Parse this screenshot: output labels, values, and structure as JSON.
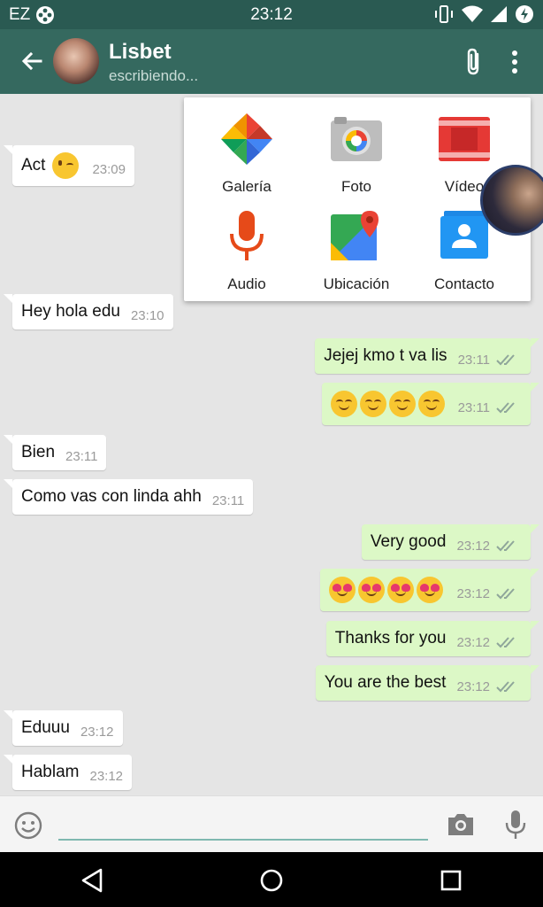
{
  "status_bar": {
    "carrier": "EZ",
    "time": "23:12"
  },
  "header": {
    "contact_name": "Lisbet",
    "contact_status": "escribiendo..."
  },
  "attach_menu": {
    "items": [
      {
        "label": "Galería",
        "icon": "gallery-icon"
      },
      {
        "label": "Foto",
        "icon": "camera-icon"
      },
      {
        "label": "Vídeo",
        "icon": "video-icon"
      },
      {
        "label": "Audio",
        "icon": "microphone-icon"
      },
      {
        "label": "Ubicación",
        "icon": "location-icon"
      },
      {
        "label": "Contacto",
        "icon": "contact-icon"
      }
    ]
  },
  "messages": [
    {
      "direction": "in",
      "text": "Act",
      "emoji": [
        "wink"
      ],
      "time": "23:09"
    },
    {
      "direction": "in",
      "text": "Hey hola edu",
      "time": "23:10"
    },
    {
      "direction": "out",
      "text": "Jejej kmo t va lis",
      "time": "23:11",
      "read": true
    },
    {
      "direction": "out",
      "text": "",
      "emoji": [
        "smile",
        "smile",
        "smile",
        "smile"
      ],
      "time": "23:11",
      "read": true
    },
    {
      "direction": "in",
      "text": "Bien",
      "time": "23:11"
    },
    {
      "direction": "in",
      "text": "Como vas con linda ahh",
      "time": "23:11"
    },
    {
      "direction": "out",
      "text": "Very good",
      "time": "23:12",
      "read": true
    },
    {
      "direction": "out",
      "text": "",
      "emoji": [
        "heart-eyes",
        "heart-eyes",
        "heart-eyes",
        "heart-eyes"
      ],
      "time": "23:12",
      "read": true
    },
    {
      "direction": "out",
      "text": "Thanks for you",
      "time": "23:12",
      "read": true
    },
    {
      "direction": "out",
      "text": "You are the best",
      "time": "23:12",
      "read": true
    },
    {
      "direction": "in",
      "text": "Eduuu",
      "time": "23:12"
    },
    {
      "direction": "in",
      "text": "Hablam",
      "time": "23:12"
    }
  ],
  "input": {
    "value": "",
    "placeholder": ""
  },
  "colors": {
    "statusbar": "#2a5a52",
    "appbar": "#35695f",
    "chat_background": "#e5e5e5",
    "outgoing_bubble": "#dcf8c6",
    "incoming_bubble": "#ffffff",
    "read_ticks": "#8fa69a",
    "input_underline": "#7fb8b0"
  }
}
